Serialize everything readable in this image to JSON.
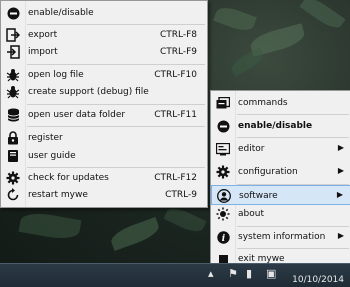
{
  "left_menu": {
    "items": [
      {
        "label": "enable/disable",
        "shortcut": "",
        "icon": "power-off-icon"
      },
      {
        "label": "export",
        "shortcut": "CTRL-F8",
        "icon": "export-icon"
      },
      {
        "label": "import",
        "shortcut": "CTRL-F9",
        "icon": "import-icon"
      },
      {
        "label": "open log file",
        "shortcut": "CTRL-F10",
        "icon": "bug-icon"
      },
      {
        "label": "create support (debug) file",
        "shortcut": "",
        "icon": "bug-icon"
      },
      {
        "label": "open user data folder",
        "shortcut": "CTRL-F11",
        "icon": "database-icon"
      },
      {
        "label": "register",
        "shortcut": "",
        "icon": "lock-icon"
      },
      {
        "label": "user guide",
        "shortcut": "",
        "icon": "book-icon"
      },
      {
        "label": "check for updates",
        "shortcut": "CTRL-F12",
        "icon": "gear-icon"
      },
      {
        "label": "restart mywe",
        "shortcut": "CTRL-9",
        "icon": "restart-icon"
      }
    ]
  },
  "right_menu": {
    "items": [
      {
        "label": "commands",
        "icon": "commands-icon",
        "submenu": false
      },
      {
        "label": "enable/disable",
        "icon": "power-off-icon",
        "submenu": false
      },
      {
        "label": "editor",
        "icon": "editor-icon",
        "submenu": true
      },
      {
        "label": "configuration",
        "icon": "gear-icon",
        "submenu": true
      },
      {
        "label": "software",
        "icon": "user-icon",
        "submenu": true
      },
      {
        "label": "about",
        "icon": "sun-icon",
        "submenu": false
      },
      {
        "label": "system information",
        "icon": "info-icon",
        "submenu": true
      },
      {
        "label": "exit mywe",
        "icon": "stop-icon",
        "submenu": false
      }
    ]
  },
  "taskbar": {
    "date": "10/10/2014"
  },
  "colors": {
    "menu_bg": "#f0f0f0",
    "highlight_bg": "#d5e6f7",
    "highlight_border": "#7eb0e2"
  }
}
